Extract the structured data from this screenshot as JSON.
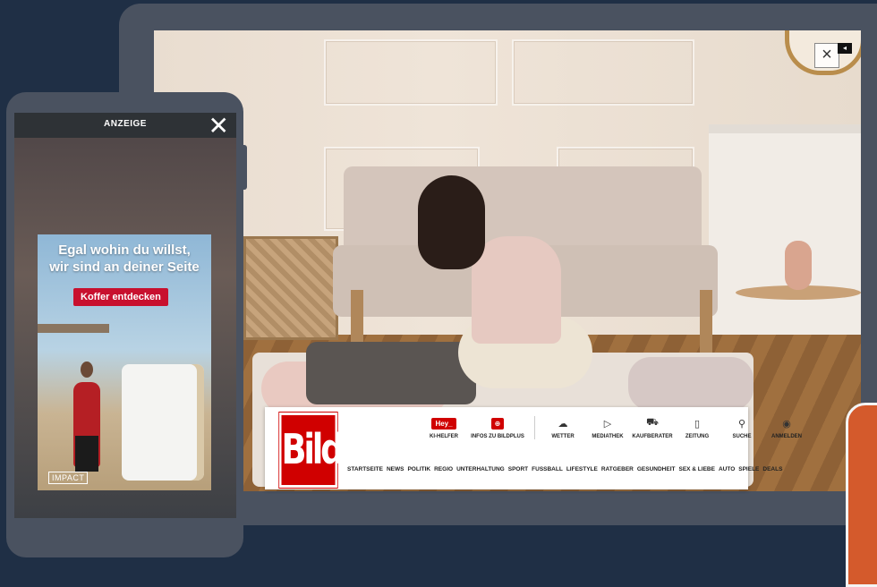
{
  "desktop": {
    "close_symbol": "×",
    "ad_marker_symbol": "◂"
  },
  "bild": {
    "logo": "Bild",
    "toolbar": [
      {
        "label": "KI-HELFER",
        "icon": "hey-chip",
        "chip": "Hey_"
      },
      {
        "label": "INFOS ZU BILDPLUS",
        "icon": "bildplus-icon",
        "chip": "⊕"
      },
      {
        "label": "WETTER",
        "icon": "cloud-icon",
        "glyph": "☁"
      },
      {
        "label": "MEDIATHEK",
        "icon": "play-icon",
        "glyph": "▷"
      },
      {
        "label": "KAUFBERATER",
        "icon": "cart-icon",
        "glyph": "⛟"
      },
      {
        "label": "ZEITUNG",
        "icon": "newspaper-icon",
        "glyph": "▯"
      },
      {
        "label": "SUCHE",
        "icon": "search-icon",
        "glyph": "⚲"
      },
      {
        "label": "ANMELDEN",
        "icon": "user-icon",
        "glyph": "◉"
      }
    ],
    "nav": [
      "STARTSEITE",
      "NEWS",
      "POLITIK",
      "REGIO",
      "UNTERHALTUNG",
      "SPORT",
      "FUSSBALL",
      "LIFESTYLE",
      "RATGEBER",
      "GESUNDHEIT",
      "SEX & LIEBE",
      "AUTO",
      "SPIELE",
      "DEALS"
    ]
  },
  "mobile_ad": {
    "label": "ANZEIGE",
    "close_symbol": "✕",
    "headline_line1": "Egal wohin du willst,",
    "headline_line2": "wir sind an deiner Seite",
    "cta": "Koffer entdecken",
    "brand": "IMPACT"
  },
  "colors": {
    "bild_red": "#d00000",
    "cta_red": "#c8102e",
    "background": "#1f2f45",
    "frame": "#4a5260",
    "accent_orange": "#d45a2c"
  }
}
